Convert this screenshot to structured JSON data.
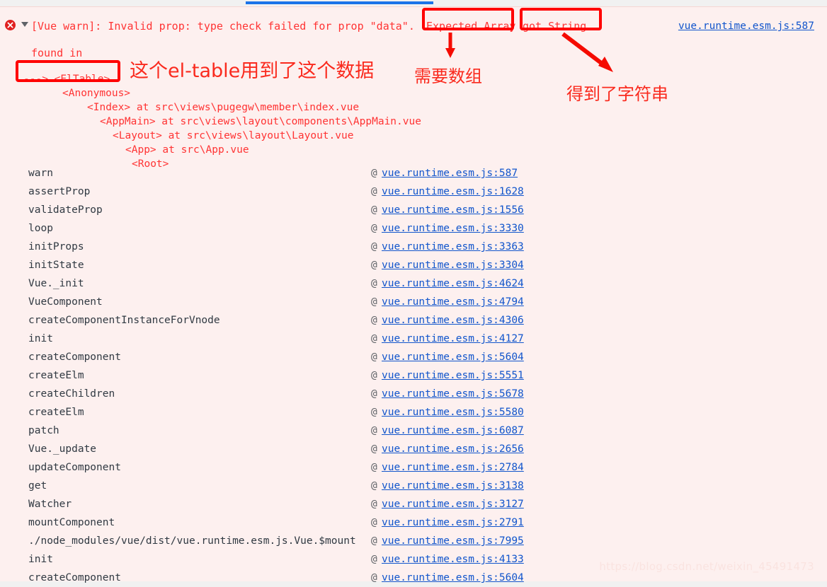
{
  "browser": {
    "active_tab_indicator": "devtools-console-tab"
  },
  "console": {
    "level_icon": "error-icon",
    "expand_icon": "triangle-down-icon",
    "warning_prefix": "[Vue warn]: Invalid prop: type check failed for prop \"data\".",
    "expected_fragment": "Expected Array",
    "comma_fragment": ",",
    "got_fragment": "got String.",
    "found_in_label": "found in",
    "source_link": "vue.runtime.esm.js:587",
    "component_trace": [
      {
        "indent": 0,
        "text": "---> <ElTable>"
      },
      {
        "indent": 1,
        "text": "<Anonymous>"
      },
      {
        "indent": 2,
        "text": "<Index> at src\\views\\pugegw\\member\\index.vue"
      },
      {
        "indent": 3,
        "text": "<AppMain> at src\\views\\layout\\components\\AppMain.vue"
      },
      {
        "indent": 4,
        "text": "<Layout> at src\\views\\layout\\Layout.vue"
      },
      {
        "indent": 5,
        "text": "<App> at src\\App.vue"
      },
      {
        "indent": 6,
        "text": "<Root>"
      }
    ],
    "at_symbol": "@",
    "stack_frames": [
      {
        "fn": "warn",
        "link": "vue.runtime.esm.js:587"
      },
      {
        "fn": "assertProp",
        "link": "vue.runtime.esm.js:1628"
      },
      {
        "fn": "validateProp",
        "link": "vue.runtime.esm.js:1556"
      },
      {
        "fn": "loop",
        "link": "vue.runtime.esm.js:3330"
      },
      {
        "fn": "initProps",
        "link": "vue.runtime.esm.js:3363"
      },
      {
        "fn": "initState",
        "link": "vue.runtime.esm.js:3304"
      },
      {
        "fn": "Vue._init",
        "link": "vue.runtime.esm.js:4624"
      },
      {
        "fn": "VueComponent",
        "link": "vue.runtime.esm.js:4794"
      },
      {
        "fn": "createComponentInstanceForVnode",
        "link": "vue.runtime.esm.js:4306"
      },
      {
        "fn": "init",
        "link": "vue.runtime.esm.js:4127"
      },
      {
        "fn": "createComponent",
        "link": "vue.runtime.esm.js:5604"
      },
      {
        "fn": "createElm",
        "link": "vue.runtime.esm.js:5551"
      },
      {
        "fn": "createChildren",
        "link": "vue.runtime.esm.js:5678"
      },
      {
        "fn": "createElm",
        "link": "vue.runtime.esm.js:5580"
      },
      {
        "fn": "patch",
        "link": "vue.runtime.esm.js:6087"
      },
      {
        "fn": "Vue._update",
        "link": "vue.runtime.esm.js:2656"
      },
      {
        "fn": "updateComponent",
        "link": "vue.runtime.esm.js:2784"
      },
      {
        "fn": "get",
        "link": "vue.runtime.esm.js:3138"
      },
      {
        "fn": "Watcher",
        "link": "vue.runtime.esm.js:3127"
      },
      {
        "fn": "mountComponent",
        "link": "vue.runtime.esm.js:2791"
      },
      {
        "fn": "./node_modules/vue/dist/vue.runtime.esm.js.Vue.$mount",
        "link": "vue.runtime.esm.js:7995"
      },
      {
        "fn": "init",
        "link": "vue.runtime.esm.js:4133"
      },
      {
        "fn": "createComponent",
        "link": "vue.runtime.esm.js:5604"
      }
    ]
  },
  "annotations": {
    "color": "#ff0000",
    "eltable_note": "这个el-table用到了这个数据",
    "expected_note": "需要数组",
    "got_note": "得到了字符串"
  },
  "watermark": {
    "text": "https://blog.csdn.net/weixin_45491473"
  }
}
